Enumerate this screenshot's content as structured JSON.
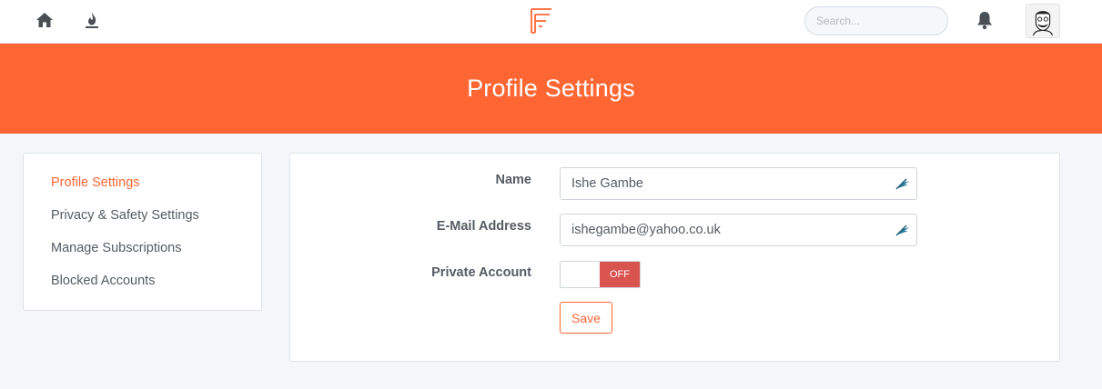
{
  "colors": {
    "accent": "#ff6633",
    "toggle_off": "#d9534f",
    "background": "#f4f6f9"
  },
  "header": {
    "icons": [
      "home-icon",
      "fire-icon",
      "logo-icon",
      "bell-icon",
      "avatar"
    ],
    "search_placeholder": "Search..."
  },
  "banner": {
    "title": "Profile Settings"
  },
  "sidebar": {
    "items": [
      {
        "label": "Profile Settings",
        "active": true
      },
      {
        "label": "Privacy & Safety Settings",
        "active": false
      },
      {
        "label": "Manage Subscriptions",
        "active": false
      },
      {
        "label": "Blocked Accounts",
        "active": false
      }
    ]
  },
  "form": {
    "name_label": "Name",
    "name_value": "Ishe Gambe",
    "email_label": "E-Mail Address",
    "email_value": "ishegambe@yahoo.co.uk",
    "private_label": "Private Account",
    "private_state": "OFF",
    "save_label": "Save"
  }
}
